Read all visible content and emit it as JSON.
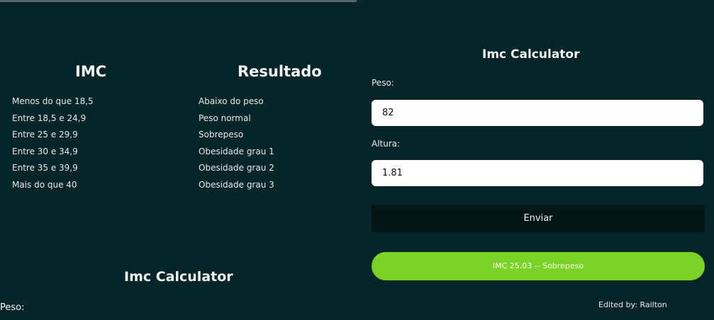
{
  "reference_table": {
    "imc_heading": "IMC",
    "result_heading": "Resultado",
    "ranges": [
      "Menos do que 18,5",
      "Entre 18,5 e 24,9",
      "Entre 25 e 29,9",
      "Entre 30 e 34,9",
      "Entre 35 e 39,9",
      "Mais do que 40"
    ],
    "results": [
      "Abaixo do peso",
      "Peso normal",
      "Sobrepeso",
      "Obesidade grau 1",
      "Obesidade grau 2",
      "Obesidade grau 3"
    ]
  },
  "left_form_preview": {
    "title": "Imc Calculator",
    "peso_label": "Peso:"
  },
  "calculator": {
    "title": "Imc Calculator",
    "peso_label": "Peso:",
    "peso_value": "82",
    "altura_label": "Altura:",
    "altura_value": "1.81",
    "submit_label": "Enviar",
    "result_text": "IMC 25.03 -- Sobrepeso",
    "edited_by": "Edited by: Railton"
  },
  "colors": {
    "background": "#0b2a2d",
    "left_panel": "#082629",
    "right_panel": "#072528",
    "button": "#031618",
    "result_pill": "#7bd226",
    "text": "#f3f5f4"
  }
}
